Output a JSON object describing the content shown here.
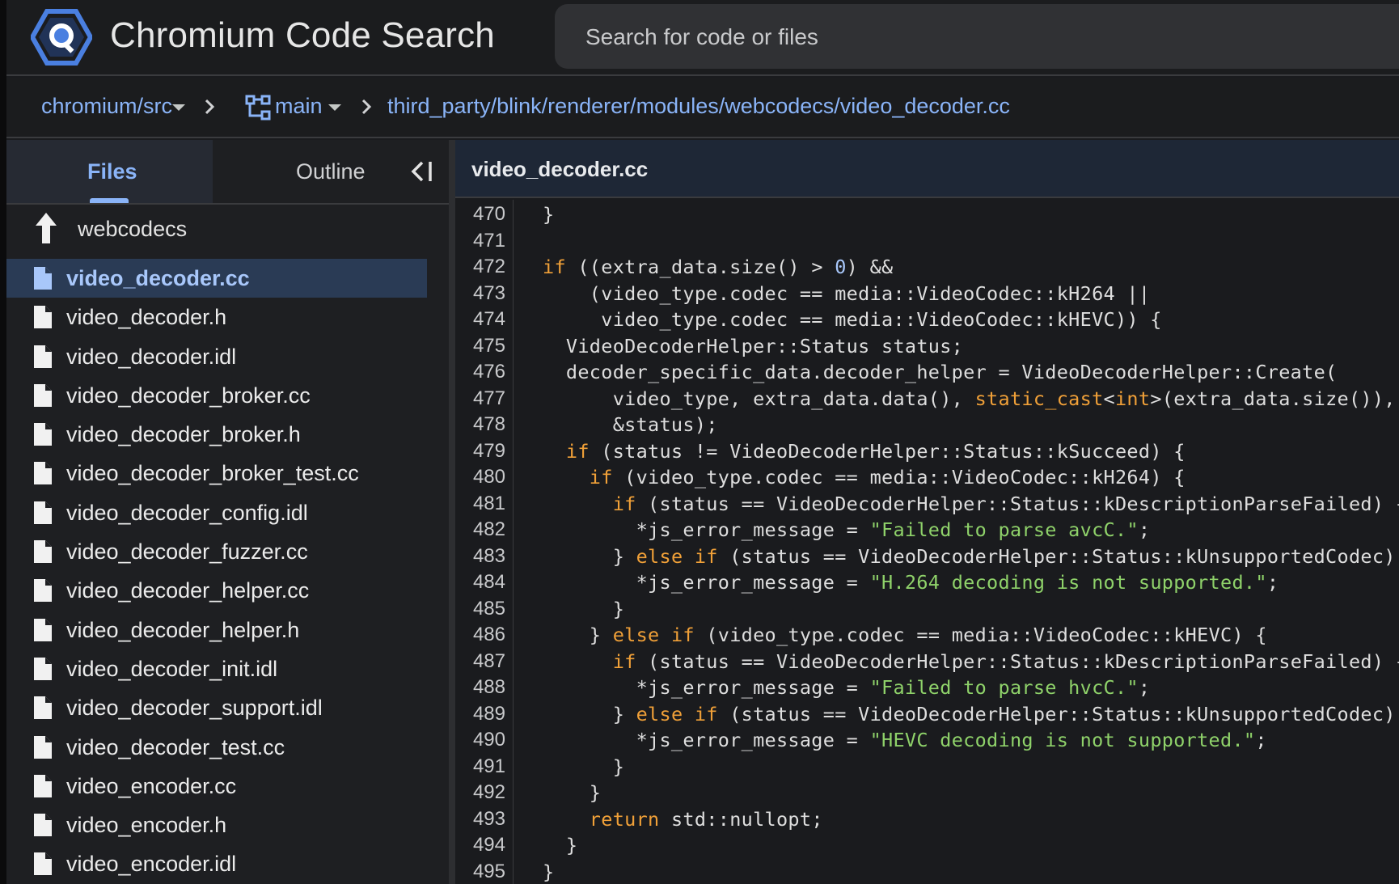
{
  "app": {
    "title": "Chromium Code Search",
    "search_placeholder": "Search for code or files"
  },
  "breadcrumb": {
    "repo": "chromium/src",
    "branch": "main",
    "path": "third_party/blink/renderer/modules/webcodecs/video_decoder.cc"
  },
  "sidebar": {
    "tab_files": "Files",
    "tab_outline": "Outline",
    "parent_dir": "webcodecs",
    "files": [
      "video_decoder.cc",
      "video_decoder.h",
      "video_decoder.idl",
      "video_decoder_broker.cc",
      "video_decoder_broker.h",
      "video_decoder_broker_test.cc",
      "video_decoder_config.idl",
      "video_decoder_fuzzer.cc",
      "video_decoder_helper.cc",
      "video_decoder_helper.h",
      "video_decoder_init.idl",
      "video_decoder_support.idl",
      "video_decoder_test.cc",
      "video_encoder.cc",
      "video_encoder.h",
      "video_encoder.idl"
    ],
    "selected_index": 0
  },
  "code": {
    "file_name": "video_decoder.cc",
    "lines": [
      {
        "n": "470",
        "t": "}"
      },
      {
        "n": "471",
        "t": ""
      },
      {
        "n": "472",
        "t": "if ((extra_data.size() > 0) &&"
      },
      {
        "n": "473",
        "t": "    (video_type.codec == media::VideoCodec::kH264 ||"
      },
      {
        "n": "474",
        "t": "     video_type.codec == media::VideoCodec::kHEVC)) {"
      },
      {
        "n": "475",
        "t": "  VideoDecoderHelper::Status status;"
      },
      {
        "n": "476",
        "t": "  decoder_specific_data.decoder_helper = VideoDecoderHelper::Create("
      },
      {
        "n": "477",
        "t": "      video_type, extra_data.data(), static_cast<int>(extra_data.size()),"
      },
      {
        "n": "478",
        "t": "      &status);"
      },
      {
        "n": "479",
        "t": "  if (status != VideoDecoderHelper::Status::kSucceed) {"
      },
      {
        "n": "480",
        "t": "    if (video_type.codec == media::VideoCodec::kH264) {"
      },
      {
        "n": "481",
        "t": "      if (status == VideoDecoderHelper::Status::kDescriptionParseFailed) {"
      },
      {
        "n": "482",
        "t": "        *js_error_message = \"Failed to parse avcC.\";"
      },
      {
        "n": "483",
        "t": "      } else if (status == VideoDecoderHelper::Status::kUnsupportedCodec) {"
      },
      {
        "n": "484",
        "t": "        *js_error_message = \"H.264 decoding is not supported.\";"
      },
      {
        "n": "485",
        "t": "      }"
      },
      {
        "n": "486",
        "t": "    } else if (video_type.codec == media::VideoCodec::kHEVC) {"
      },
      {
        "n": "487",
        "t": "      if (status == VideoDecoderHelper::Status::kDescriptionParseFailed) {"
      },
      {
        "n": "488",
        "t": "        *js_error_message = \"Failed to parse hvcC.\";"
      },
      {
        "n": "489",
        "t": "      } else if (status == VideoDecoderHelper::Status::kUnsupportedCodec) {"
      },
      {
        "n": "490",
        "t": "        *js_error_message = \"HEVC decoding is not supported.\";"
      },
      {
        "n": "491",
        "t": "      }"
      },
      {
        "n": "492",
        "t": "    }"
      },
      {
        "n": "493",
        "t": "    return std::nullopt;"
      },
      {
        "n": "494",
        "t": "  }"
      },
      {
        "n": "495",
        "t": "}"
      }
    ]
  },
  "colors": {
    "accent": "#8ab4f8",
    "keyword": "#f0a038",
    "string": "#8fd26a",
    "number": "#a8c7fa",
    "selected_bg": "#2a3b55"
  },
  "icons": {
    "logo": "code-search-logo-icon",
    "branch": "branch-icon",
    "collapse": "collapse-panel-icon",
    "parent": "arrow-up-icon",
    "file": "file-icon"
  }
}
